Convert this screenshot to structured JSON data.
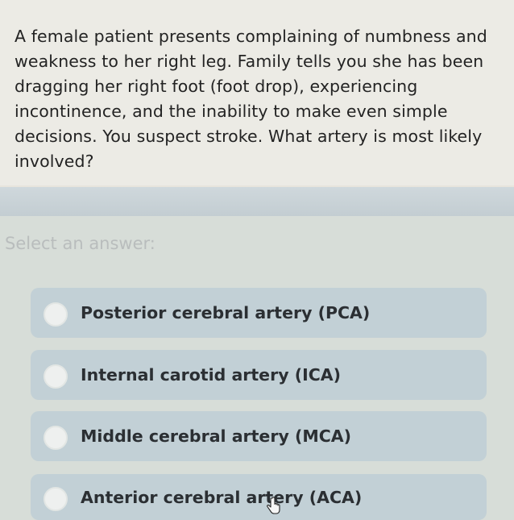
{
  "question": {
    "text": "A female patient presents complaining of numbness and weakness to her right leg. Family tells you she has been dragging her right foot (foot drop), experiencing incontinence, and the inability to make even simple decisions. You suspect stroke. What artery is most likely involved?"
  },
  "answers": {
    "prompt": "Select an answer:",
    "options": [
      {
        "label": "Posterior cerebral artery (PCA)"
      },
      {
        "label": "Internal carotid artery (ICA)"
      },
      {
        "label": "Middle cerebral artery (MCA)"
      },
      {
        "label": "Anterior cerebral artery (ACA)"
      }
    ]
  },
  "colors": {
    "option_background": "#c2d0d6",
    "text": "#232323",
    "prompt_text": "#b9bdbd"
  },
  "icons": {
    "cursor": "hand-pointer-icon",
    "radio": "radio-unselected"
  }
}
